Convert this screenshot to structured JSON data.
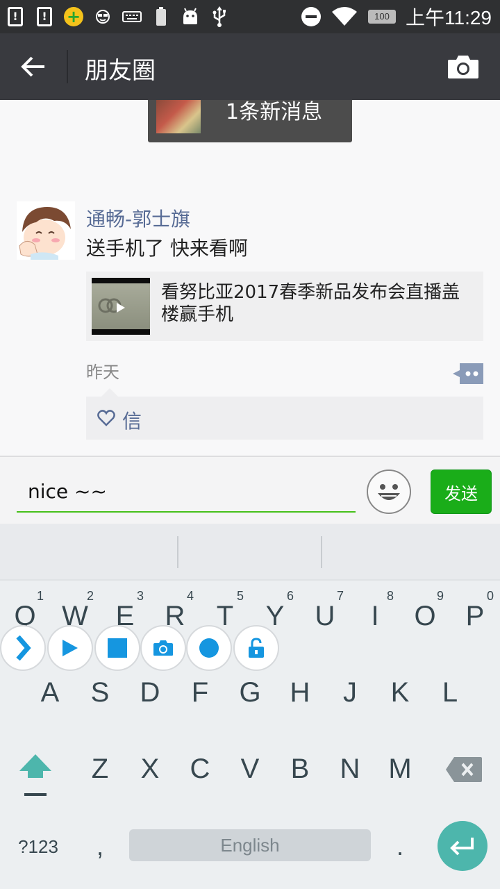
{
  "status_bar": {
    "time": "上午11:29",
    "battery_level": "100",
    "icons": [
      "notification-icon",
      "notification-icon",
      "app-plus-icon",
      "glasses-icon",
      "keyboard-icon",
      "battery-icon",
      "android-icon",
      "usb-icon",
      "do-not-disturb-icon",
      "wifi-icon",
      "battery-badge"
    ]
  },
  "header": {
    "title": "朋友圈",
    "back_icon": "arrow-left-icon",
    "camera_icon": "camera-icon"
  },
  "new_message_banner": {
    "text": "1条新消息"
  },
  "post": {
    "author": "通畅-郭士旗",
    "text": "送手机了 快来看啊",
    "link_title": "看努比亚2017春季新品发布会直播盖楼赢手机",
    "time": "昨天",
    "likes": [
      "信"
    ]
  },
  "comment_bar": {
    "input_value": "nice ~~",
    "send_label": "发送"
  },
  "keyboard": {
    "row1": [
      "Q",
      "W",
      "E",
      "R",
      "T",
      "Y",
      "U",
      "I",
      "O",
      "P"
    ],
    "row1_hints": [
      "1",
      "2",
      "3",
      "4",
      "5",
      "6",
      "7",
      "8",
      "9",
      "0"
    ],
    "row2": [
      "A",
      "S",
      "D",
      "F",
      "G",
      "H",
      "J",
      "K",
      "L"
    ],
    "row3": [
      "Z",
      "X",
      "C",
      "V",
      "B",
      "N",
      "M"
    ],
    "symbols_label": "?123",
    "comma": ",",
    "space_label": "English",
    "period": ".",
    "accent_color": "#4db6ac"
  },
  "floating_toolbar": {
    "icons": [
      "chevron-right-icon",
      "play-icon",
      "stop-icon",
      "camera-icon",
      "record-icon",
      "unlock-icon"
    ]
  }
}
